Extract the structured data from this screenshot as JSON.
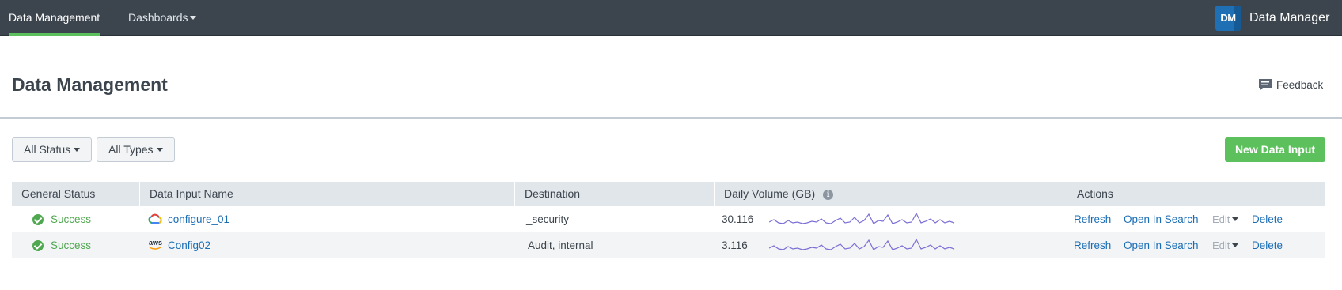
{
  "nav": {
    "items": [
      {
        "label": "Data Management",
        "active": true
      },
      {
        "label": "Dashboards",
        "active": false
      }
    ],
    "app_logo_text": "DM",
    "app_name": "Data Manager"
  },
  "page": {
    "title": "Data Management",
    "feedback_label": "Feedback"
  },
  "filters": {
    "status_label": "All Status",
    "types_label": "All Types",
    "new_input_label": "New Data Input"
  },
  "table": {
    "columns": [
      "General Status",
      "Data Input Name",
      "Destination",
      "Daily Volume (GB)",
      "Actions"
    ],
    "rows": [
      {
        "status": "Success",
        "source_icon": "google-cloud-icon",
        "name": "configure_01",
        "destination": "_security",
        "volume": "30.116",
        "actions": {
          "refresh": "Refresh",
          "open": "Open In Search",
          "edit": "Edit",
          "delete": "Delete"
        }
      },
      {
        "status": "Success",
        "source_icon": "aws-icon",
        "aws_text": "aws",
        "name": "Config02",
        "destination": "Audit, internal",
        "volume": "3.116",
        "actions": {
          "refresh": "Refresh",
          "open": "Open In Search",
          "edit": "Edit",
          "delete": "Delete"
        }
      }
    ]
  },
  "colors": {
    "topbar": "#3c444d",
    "accent_green": "#5cc05c",
    "success_text": "#4fa84f",
    "link": "#1a6db5",
    "sparkline": "#7b6fd6"
  }
}
